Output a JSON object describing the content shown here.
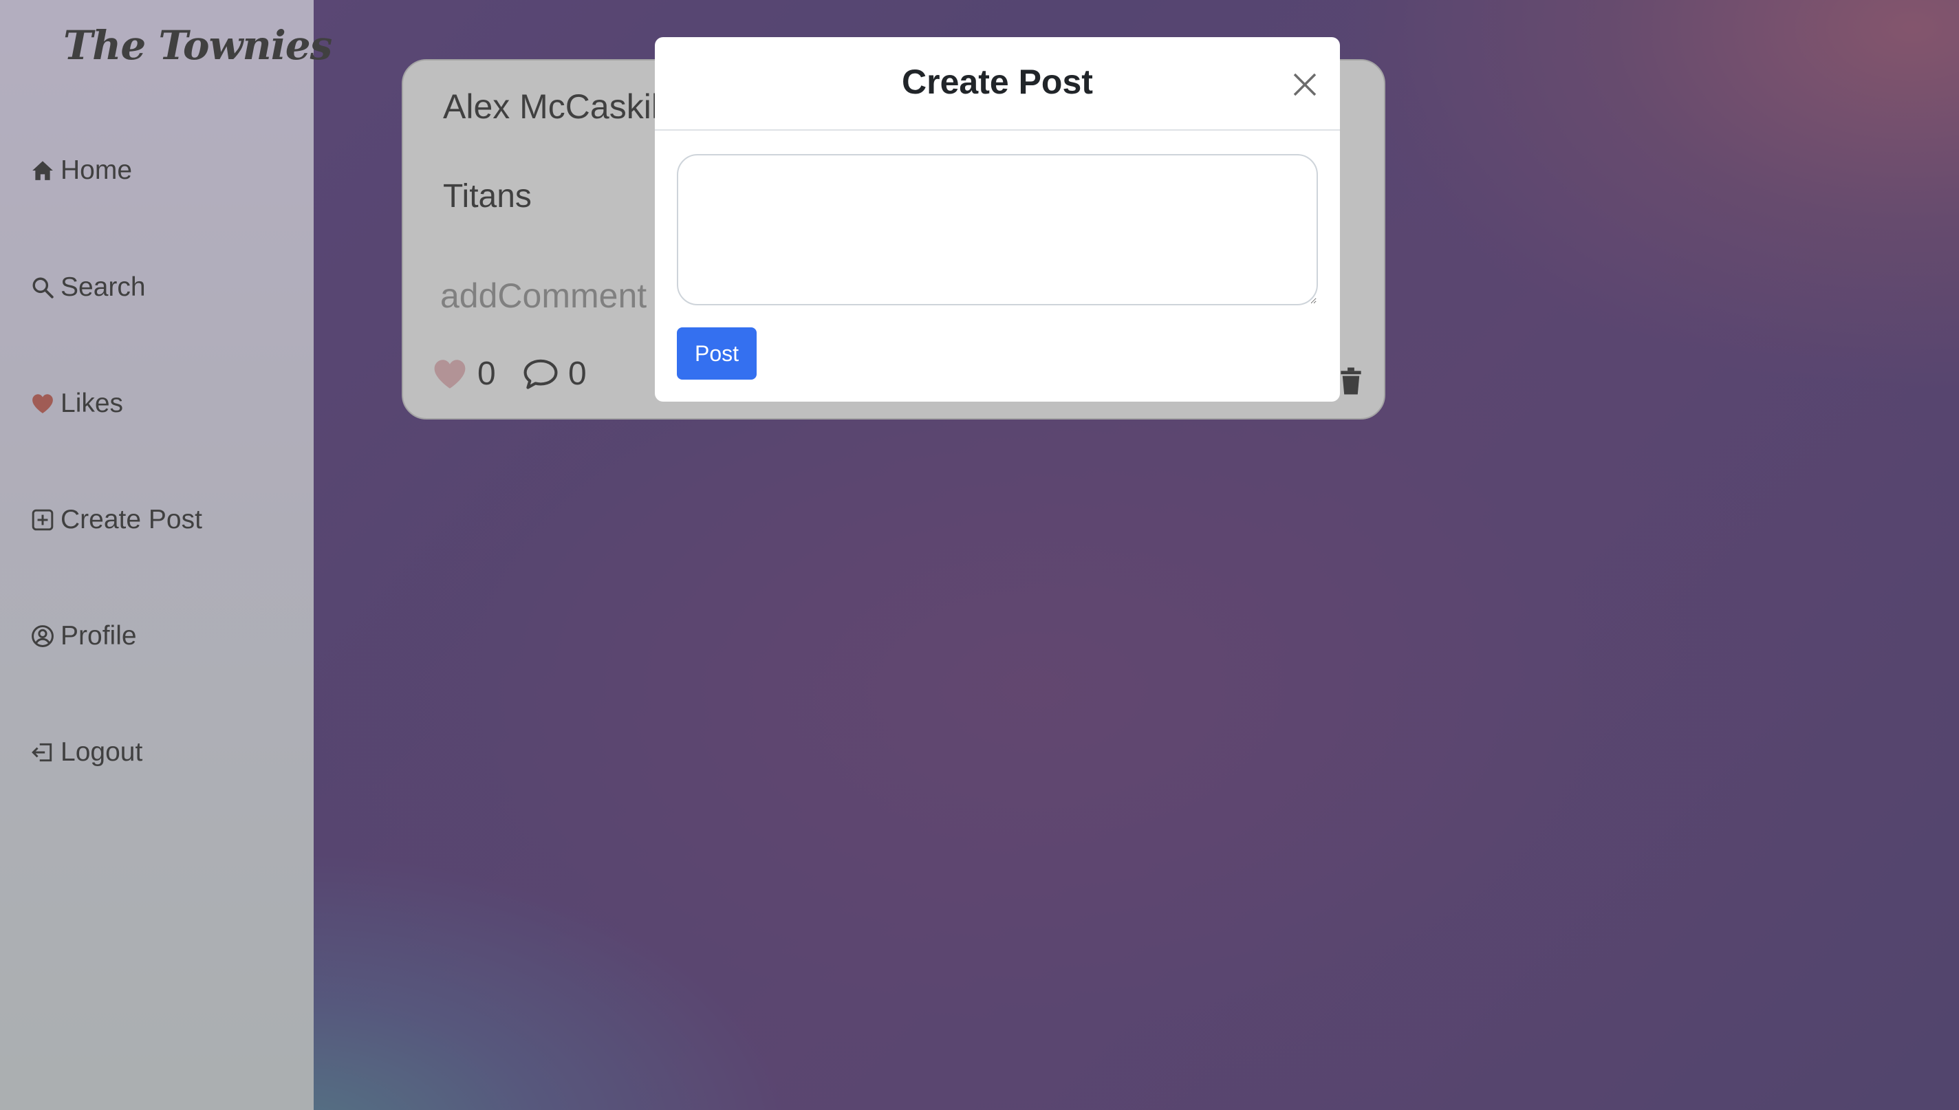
{
  "app": {
    "logo_text": "The Townies"
  },
  "sidebar": {
    "items": [
      {
        "label": "Home",
        "icon": "house-icon"
      },
      {
        "label": "Search",
        "icon": "search-icon"
      },
      {
        "label": "Likes",
        "icon": "heart-icon"
      },
      {
        "label": "Create Post",
        "icon": "plus-square-icon"
      },
      {
        "label": "Profile",
        "icon": "person-circle-icon"
      },
      {
        "label": "Logout",
        "icon": "logout-icon"
      }
    ]
  },
  "post": {
    "author": "Alex McCaskill",
    "content": "Titans",
    "comment_placeholder": "addComment",
    "likes_count": "0",
    "comments_count": "0"
  },
  "modal": {
    "title": "Create Post",
    "textarea_value": "",
    "post_button_label": "Post"
  },
  "colors": {
    "accent_blue": "#3470f0",
    "like_heart": "#c0392b",
    "overlay": "rgba(128,128,128,0.5)"
  }
}
